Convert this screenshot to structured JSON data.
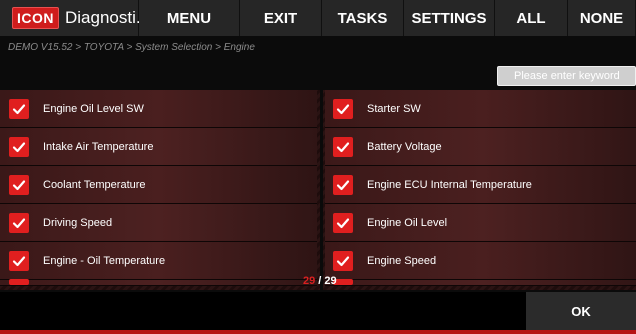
{
  "app": {
    "logo": "ICON",
    "title": "Diagnosti..."
  },
  "menu": [
    {
      "label": "MENU",
      "name": "menu-button",
      "width": 101
    },
    {
      "label": "EXIT",
      "name": "exit-button",
      "width": 82
    },
    {
      "label": "TASKS",
      "name": "tasks-button",
      "width": 82
    },
    {
      "label": "SETTINGS",
      "name": "settings-button",
      "width": 91
    },
    {
      "label": "ALL",
      "name": "select-all-button",
      "width": 73
    },
    {
      "label": "NONE",
      "name": "select-none-button",
      "width": 68
    }
  ],
  "breadcrumb": "DEMO V15.52 > TOYOTA > System Selection > Engine",
  "search": {
    "placeholder": "Please enter keyword"
  },
  "items_left": [
    {
      "label": "Engine Oil Level SW",
      "checked": true
    },
    {
      "label": "Intake Air Temperature",
      "checked": true
    },
    {
      "label": "Coolant Temperature",
      "checked": true
    },
    {
      "label": "Driving Speed",
      "checked": true
    },
    {
      "label": "Engine - Oil Temperature",
      "checked": true
    }
  ],
  "items_right": [
    {
      "label": "Starter SW",
      "checked": true
    },
    {
      "label": "Battery Voltage",
      "checked": true
    },
    {
      "label": "Engine ECU Internal Temperature",
      "checked": true
    },
    {
      "label": "Engine Oil Level",
      "checked": true
    },
    {
      "label": "Engine Speed",
      "checked": true
    }
  ],
  "pager": {
    "current": "29",
    "separator": " / ",
    "total": "29"
  },
  "ok_label": "OK",
  "colors": {
    "accent": "#e01f1f",
    "bar": "#262626"
  }
}
